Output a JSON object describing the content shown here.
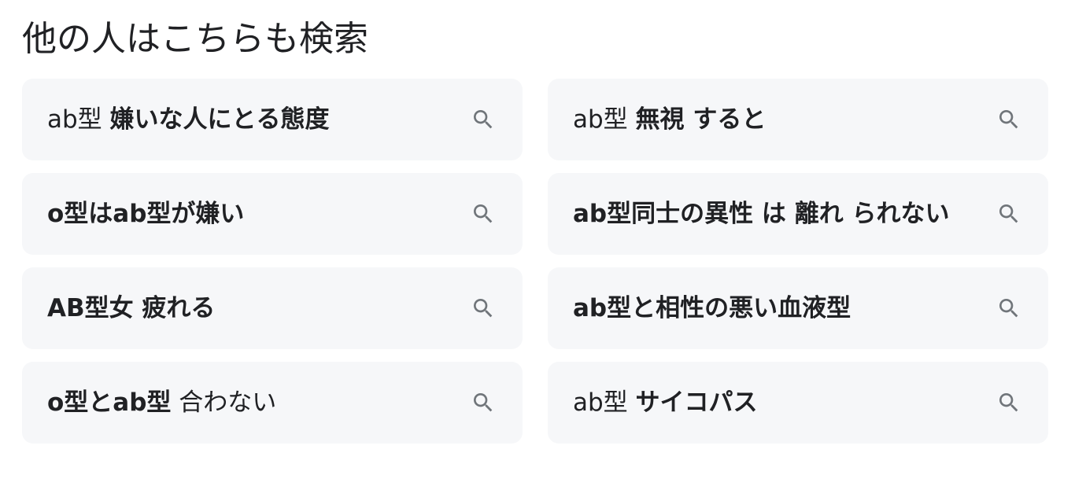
{
  "section": {
    "title": "他の人はこちらも検索"
  },
  "suggestions": [
    {
      "parts": [
        {
          "text": "ab型 ",
          "bold": false
        },
        {
          "text": "嫌いな人にとる態度",
          "bold": true
        }
      ]
    },
    {
      "parts": [
        {
          "text": "ab型 ",
          "bold": false
        },
        {
          "text": "無視 すると",
          "bold": true
        }
      ]
    },
    {
      "parts": [
        {
          "text": "o型はab型が嫌い",
          "bold": true
        }
      ]
    },
    {
      "parts": [
        {
          "text": "ab型同士の異性 は 離れ られない",
          "bold": true
        }
      ]
    },
    {
      "parts": [
        {
          "text": "AB型女 疲れる",
          "bold": true
        }
      ]
    },
    {
      "parts": [
        {
          "text": "ab型と相性の悪い血液型",
          "bold": true
        }
      ]
    },
    {
      "parts": [
        {
          "text": "o型とab型",
          "bold": true
        },
        {
          "text": " 合わない",
          "bold": false
        }
      ]
    },
    {
      "parts": [
        {
          "text": "ab型 ",
          "bold": false
        },
        {
          "text": "サイコパス",
          "bold": true
        }
      ]
    }
  ],
  "icons": {
    "suggestion_icon": "search-icon"
  },
  "colors": {
    "chip_background": "#f6f7f9",
    "text": "#202124",
    "icon": "#70757a"
  }
}
